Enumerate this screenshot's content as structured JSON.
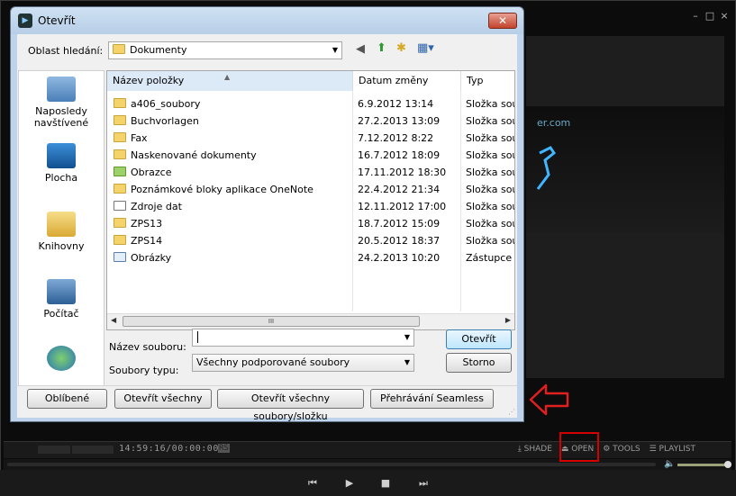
{
  "player": {
    "timecode": "14:59:16/00:00:00",
    "rs_label": "RS",
    "tools": [
      {
        "icon": "download-icon",
        "label": "SHADE"
      },
      {
        "icon": "eject-icon",
        "label": "OPEN"
      },
      {
        "icon": "gear-icon",
        "label": "TOOLS"
      },
      {
        "icon": "list-icon",
        "label": "PLAYLIST"
      }
    ],
    "watermark": "er.com",
    "help_label": "?"
  },
  "dialog": {
    "title": "Otevřít",
    "close_label": "✕",
    "look_in_label": "Oblast hledání:",
    "look_in_value": "Dokumenty",
    "places": [
      {
        "label": "Naposledy navštívené"
      },
      {
        "label": "Plocha"
      },
      {
        "label": "Knihovny"
      },
      {
        "label": "Počítač"
      },
      {
        "label": ""
      }
    ],
    "columns": [
      "Název položky",
      "Datum změny",
      "Typ"
    ],
    "files": [
      {
        "name": "a406_soubory",
        "date": "6.9.2012 13:14",
        "type": "Složka sou",
        "icon": "folder-icon"
      },
      {
        "name": "Buchvorlagen",
        "date": "27.2.2013 13:09",
        "type": "Složka sou",
        "icon": "folder-icon"
      },
      {
        "name": "Fax",
        "date": "7.12.2012 8:22",
        "type": "Složka sou",
        "icon": "folder-icon"
      },
      {
        "name": "Naskenované dokumenty",
        "date": "16.7.2012 18:09",
        "type": "Složka sou",
        "icon": "folder-icon"
      },
      {
        "name": "Obrazce",
        "date": "17.11.2012 18:30",
        "type": "Složka sou",
        "icon": "shapes-folder-icon"
      },
      {
        "name": "Poznámkové bloky aplikace OneNote",
        "date": "22.4.2012 21:34",
        "type": "Složka sou",
        "icon": "folder-icon"
      },
      {
        "name": "Zdroje dat",
        "date": "12.11.2012 17:00",
        "type": "Složka sou",
        "icon": "data-sources-icon"
      },
      {
        "name": "ZPS13",
        "date": "18.7.2012 15:09",
        "type": "Složka sou",
        "icon": "folder-icon"
      },
      {
        "name": "ZPS14",
        "date": "20.5.2012 18:37",
        "type": "Složka sou",
        "icon": "folder-icon"
      },
      {
        "name": "Obrázky",
        "date": "24.2.2013 10:20",
        "type": "Zástupce",
        "icon": "shortcut-icon"
      }
    ],
    "scroll_thumb_label": "III",
    "filename_label": "Název souboru:",
    "filename_value": "",
    "filetype_label": "Soubory typu:",
    "filetype_value": "Všechny podporované soubory",
    "open_label": "Otevřít",
    "cancel_label": "Storno",
    "bottom_buttons": [
      "Oblíbené",
      "Otevřít všechny",
      "Otevřít všechny soubory/složku",
      "Přehrávání Seamless"
    ]
  }
}
